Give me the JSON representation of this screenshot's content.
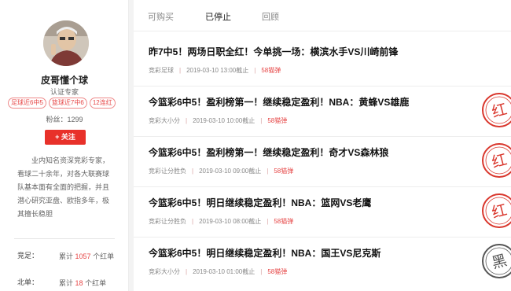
{
  "profile": {
    "name": "皮哥懂个球",
    "certification": "认证专家",
    "tags": [
      "足球近6中5",
      "篮球近7中6",
      "12连红"
    ],
    "fans": "粉丝：1299",
    "follow_label": "+ 关注",
    "bio": "业内知名资深竞彩专家，看球二十余年，对各大联赛球队基本面有全面的把握，并且潜心研究亚盘、欧指多年，极其擅长稳胆",
    "stats": [
      {
        "label": "竞足：",
        "prefix": "累计",
        "count": "1057",
        "suffix": "个红单"
      },
      {
        "label": "北单：",
        "prefix": "累计",
        "count": "18",
        "suffix": "个红单"
      }
    ]
  },
  "tabs": [
    {
      "label": "可购买",
      "active": false
    },
    {
      "label": "已停止",
      "active": true
    },
    {
      "label": "回顾",
      "active": false
    }
  ],
  "items": [
    {
      "title": "昨7中5！两场日职全红！今单挑一场：横滨水手VS川崎前锋",
      "category": "竞彩足球",
      "time": "2019-03-10 13:00截止",
      "price": "58猫弹",
      "stamp": "none"
    },
    {
      "title": "今篮彩6中5！盈利榜第一！继续稳定盈利！NBA：黄蜂VS雄鹿",
      "category": "竞彩大小分",
      "time": "2019-03-10 10:00截止",
      "price": "58猫弹",
      "stamp": "红"
    },
    {
      "title": "今篮彩6中5！盈利榜第一！继续稳定盈利！奇才VS森林狼",
      "category": "竞彩让分胜负",
      "time": "2019-03-10 09:00截止",
      "price": "58猫弹",
      "stamp": "红"
    },
    {
      "title": "今篮彩6中5！明日继续稳定盈利！NBA：篮网VS老鹰",
      "category": "竞彩让分胜负",
      "time": "2019-03-10 08:00截止",
      "price": "58猫弹",
      "stamp": "红"
    },
    {
      "title": "今篮彩6中5！明日继续稳定盈利！NBA：国王VS尼克斯",
      "category": "竞彩大小分",
      "time": "2019-03-10 01:00截止",
      "price": "58猫弹",
      "stamp": "黑"
    }
  ],
  "colors": {
    "accent": "#e8312a",
    "stamp_red": "#d9362c",
    "stamp_black": "#555555"
  }
}
